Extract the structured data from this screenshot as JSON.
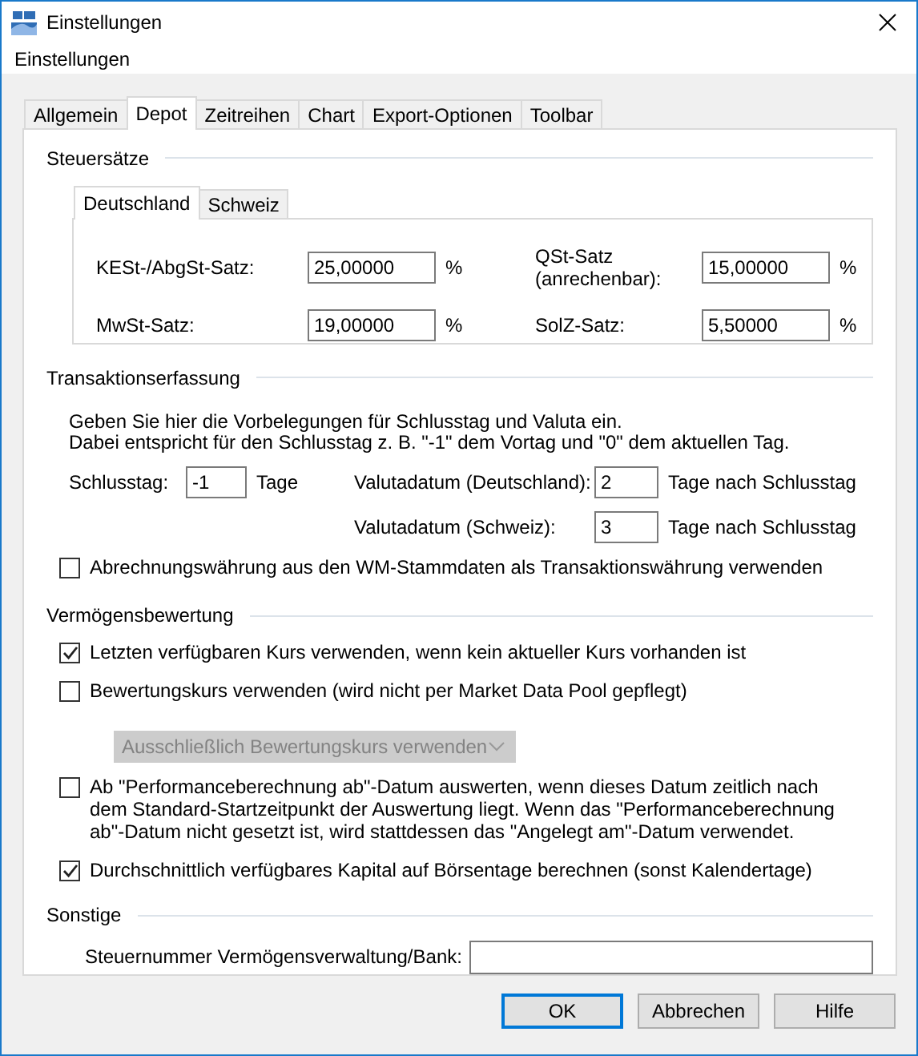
{
  "window": {
    "title": "Einstellungen"
  },
  "menu": [
    "Einstellungen"
  ],
  "tabs": [
    {
      "label": "Allgemein",
      "selected": false
    },
    {
      "label": "Depot",
      "selected": true
    },
    {
      "label": "Zeitreihen",
      "selected": false
    },
    {
      "label": "Chart",
      "selected": false
    },
    {
      "label": "Export-Optionen",
      "selected": false
    },
    {
      "label": "Toolbar",
      "selected": false
    }
  ],
  "tax_rates": {
    "title": "Steuersätze",
    "tabs": [
      {
        "label": "Deutschland",
        "selected": true
      },
      {
        "label": "Schweiz",
        "selected": false
      }
    ],
    "fields": [
      {
        "label": "KESt-/AbgSt-Satz:",
        "value": "25,00000",
        "unit": "%"
      },
      {
        "label": "QSt-Satz (anrechenbar):",
        "value": "15,00000",
        "unit": "%"
      },
      {
        "label": "MwSt-Satz:",
        "value": "19,00000",
        "unit": "%"
      },
      {
        "label": "SolZ-Satz:",
        "value": "5,50000",
        "unit": "%"
      }
    ]
  },
  "transactions": {
    "title": "Transaktionserfassung",
    "description": [
      "Geben Sie hier die Vorbelegungen für Schlusstag und Valuta ein.",
      "Dabei entspricht für den Schlusstag z. B. \"-1\" dem Vortag und \"0\" dem aktuellen Tag."
    ],
    "trade_day": {
      "label": "Schlusstag:",
      "value": "-1",
      "unit": "Tage"
    },
    "value_dates": [
      {
        "label": "Valutadatum (Deutschland):",
        "value": "2",
        "unit": "Tage nach Schlusstag"
      },
      {
        "label": "Valutadatum (Schweiz):",
        "value": "3",
        "unit": "Tage nach Schlusstag"
      }
    ],
    "option": {
      "label": "Abrechnungswährung aus den WM-Stammdaten als Transaktionswährung verwenden",
      "checked": false
    }
  },
  "valuation": {
    "title": "Vermögensbewertung",
    "options": [
      {
        "kind": "checkbox",
        "label": "Letzten verfügbaren Kurs verwenden, wenn kein aktueller Kurs vorhanden ist",
        "checked": true
      },
      {
        "kind": "checkbox",
        "label": "Bewertungskurs verwenden (wird nicht per Market Data Pool gepflegt)",
        "checked": false
      },
      {
        "kind": "select",
        "value": "Ausschließlich Bewertungskurs verwenden",
        "disabled": true
      },
      {
        "kind": "checkbox",
        "label": "Ab \"Performanceberechnung ab\"-Datum auswerten, wenn dieses Datum zeitlich nach dem Standard-Startzeitpunkt der Auswertung liegt. Wenn das \"Performanceberechnung ab\"-Datum nicht gesetzt ist, wird stattdessen das \"Angelegt am\"-Datum verwendet.",
        "checked": false
      },
      {
        "kind": "checkbox",
        "label": "Durchschnittlich verfügbares Kapital auf Börsentage berechnen (sonst Kalendertage)",
        "checked": true
      }
    ]
  },
  "other": {
    "title": "Sonstige",
    "field": {
      "label": "Steuernummer Vermögensverwaltung/Bank:"
    }
  },
  "buttons": [
    {
      "label": "OK",
      "default": true
    },
    {
      "label": "Abbrechen",
      "default": false
    },
    {
      "label": "Hilfe",
      "default": false
    }
  ]
}
